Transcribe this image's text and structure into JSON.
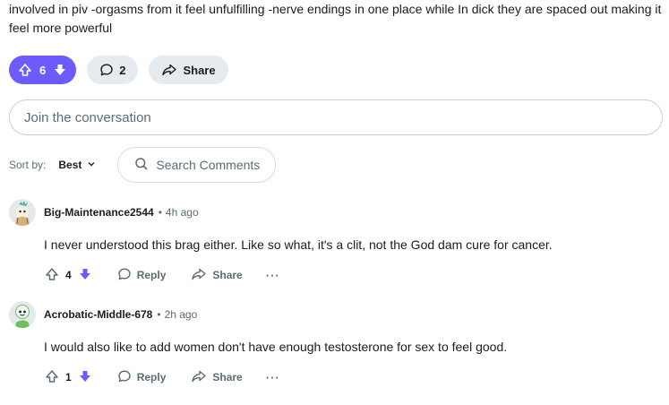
{
  "post": {
    "text": "involved in piv -orgasms from it feel unfulfilling -nerve endings in one place while In dick they are spaced out making it feel more powerful",
    "vote_count": "6",
    "comment_count": "2",
    "share_label": "Share"
  },
  "join": {
    "placeholder": "Join the conversation"
  },
  "sort": {
    "label": "Sort by:",
    "value": "Best"
  },
  "search": {
    "placeholder": "Search Comments"
  },
  "comments": [
    {
      "author": "Big-Maintenance2544",
      "separator": "•",
      "time": "4h ago",
      "text": "I never understood this brag either. Like so what, it's a clit, not the God dam cure for cancer.",
      "votes": "4",
      "reply_label": "Reply",
      "share_label": "Share",
      "more": "···"
    },
    {
      "author": "Acrobatic-Middle-678",
      "separator": "•",
      "time": "2h ago",
      "text": "I would also like to add women don't have enough testosterone for sex to feel good.",
      "votes": "1",
      "reply_label": "Reply",
      "share_label": "Share",
      "more": "···"
    }
  ],
  "colors": {
    "accent": "#6a5cff",
    "downvote": "#6a5cff",
    "pill_bg": "#e5ebee"
  }
}
